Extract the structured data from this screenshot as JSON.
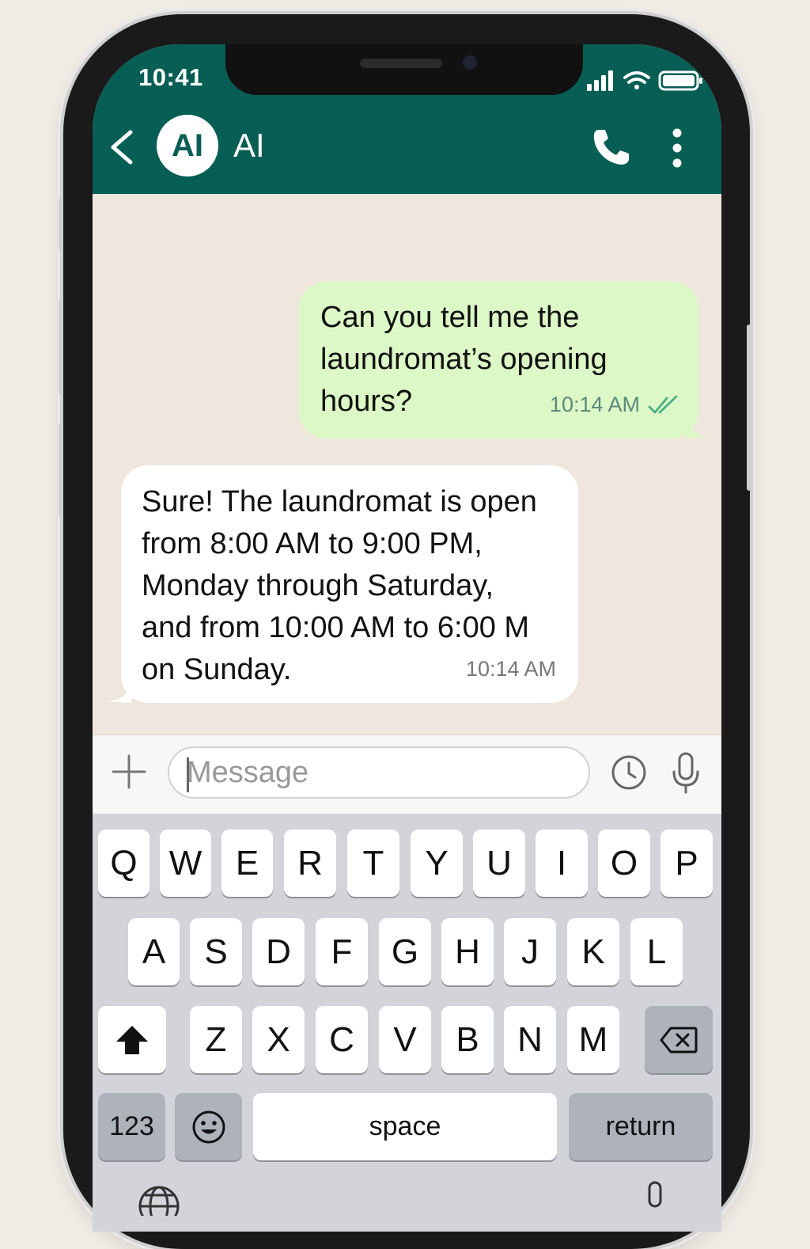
{
  "status_bar": {
    "time": "10:41"
  },
  "header": {
    "avatar_initials": "AI",
    "contact_name": "AI"
  },
  "messages": [
    {
      "direction": "outgoing",
      "text": "Can you tell me the\nlaundromat’s opening\nhours?",
      "time": "10:14 AM",
      "status": "read"
    },
    {
      "direction": "incoming",
      "text": "Sure! The laundromat is open\nfrom 8:00 AM to 9:00 PM,\nMonday through Saturday,\nand from 10:00 AM to 6:00 M\non Sunday.",
      "time": "10:14 AM"
    }
  ],
  "composer": {
    "placeholder": "Message"
  },
  "keyboard": {
    "row1": [
      "Q",
      "W",
      "E",
      "R",
      "T",
      "Y",
      "U",
      "I",
      "O",
      "P"
    ],
    "row2": [
      "A",
      "S",
      "D",
      "F",
      "G",
      "H",
      "J",
      "K",
      "L"
    ],
    "row3": [
      "Z",
      "X",
      "C",
      "V",
      "B",
      "N",
      "M"
    ],
    "numbers_label": "123",
    "space_label": "space",
    "return_label": "return"
  },
  "colors": {
    "header": "#075e54",
    "outgoing_bubble": "#dcf8c6",
    "incoming_bubble": "#ffffff",
    "chat_background": "#efe7dd",
    "read_ticks": "#34b7f1"
  }
}
